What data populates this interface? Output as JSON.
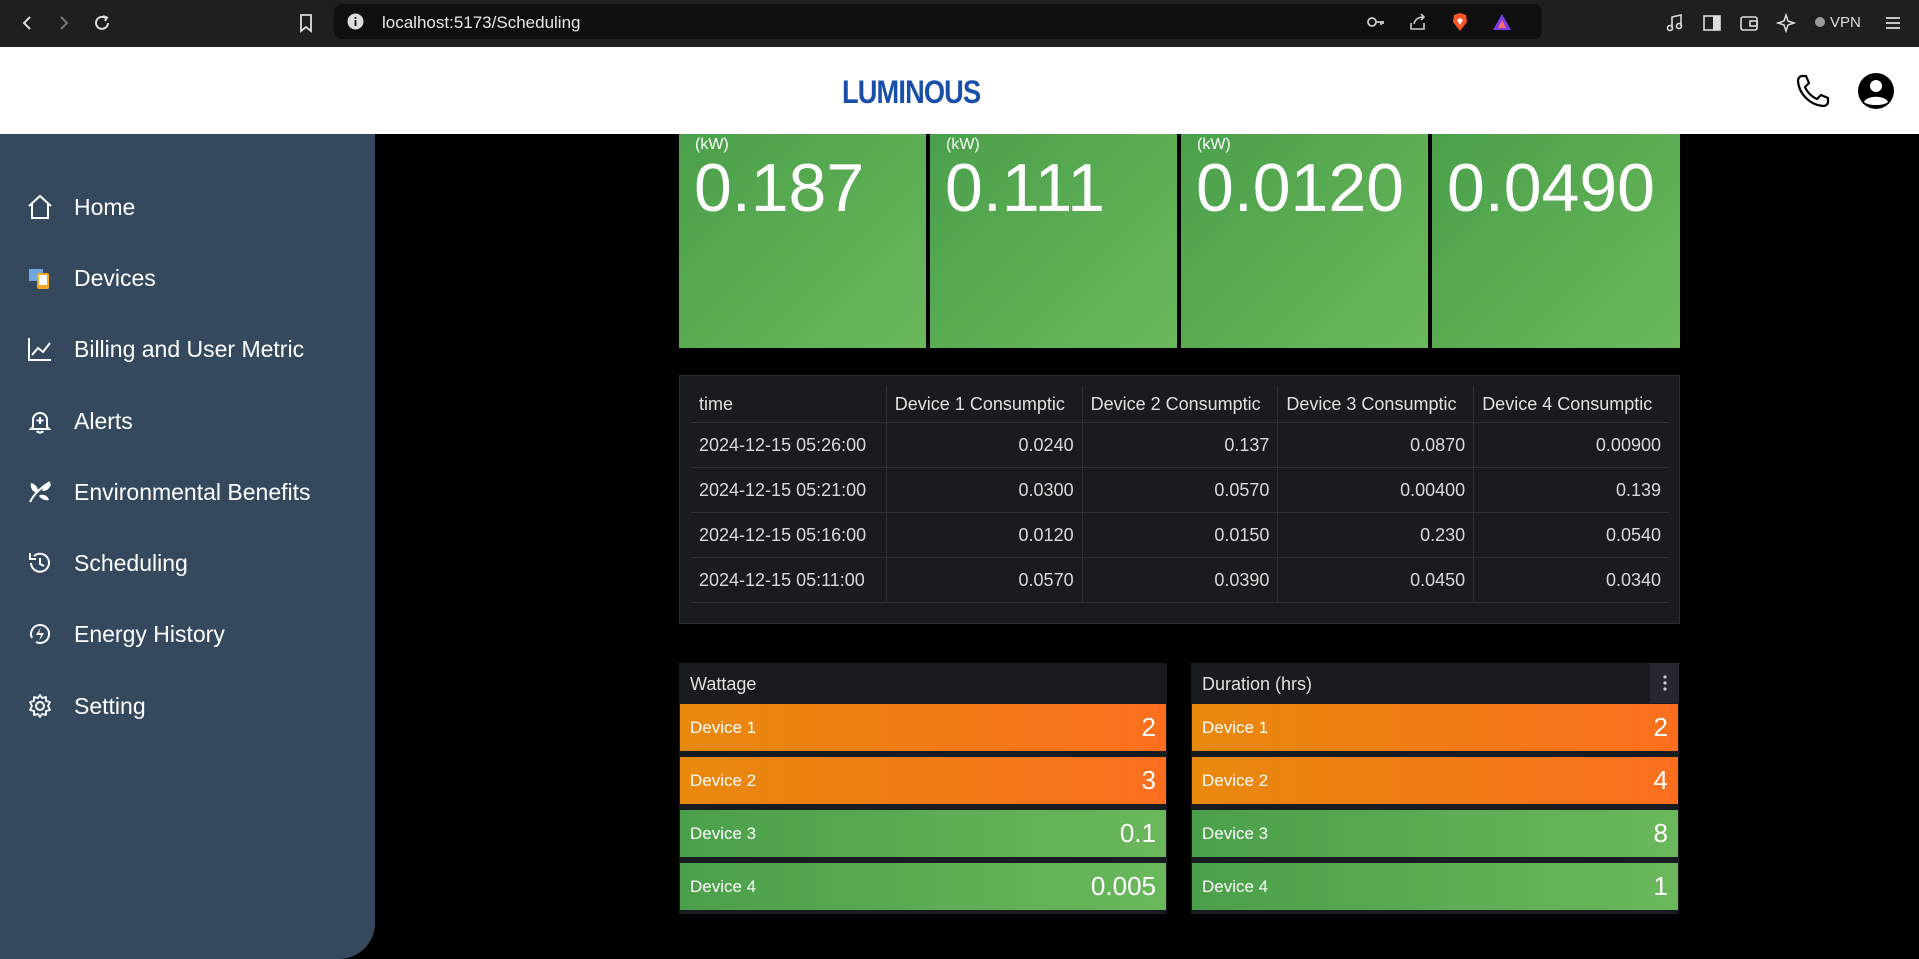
{
  "browser": {
    "url": "localhost:5173/Scheduling",
    "vpn_label": "VPN"
  },
  "header": {
    "logo": "LUMINOUS",
    "icons": [
      "phone-icon",
      "account-icon"
    ]
  },
  "sidebar": {
    "items": [
      {
        "label": "Home",
        "icon": "home-icon"
      },
      {
        "label": "Devices",
        "icon": "devices-icon"
      },
      {
        "label": "Billing and User Metric",
        "icon": "chart-line-icon"
      },
      {
        "label": "Alerts",
        "icon": "bell-icon"
      },
      {
        "label": "Environmental Benefits",
        "icon": "leaf-icon"
      },
      {
        "label": "Scheduling",
        "icon": "history-icon"
      },
      {
        "label": "Energy History",
        "icon": "energy-icon"
      },
      {
        "label": "Setting",
        "icon": "gear-icon"
      }
    ]
  },
  "stats": [
    {
      "unit": "(kW)",
      "value": "0.187"
    },
    {
      "unit": "(kW)",
      "value": "0.111"
    },
    {
      "unit": "(kW)",
      "value": "0.0120"
    },
    {
      "unit": "",
      "value": "0.0490"
    }
  ],
  "table": {
    "columns": [
      "time",
      "Device 1 Consumptic",
      "Device 2 Consumptic",
      "Device 3 Consumptic",
      "Device 4 Consumptic"
    ],
    "rows": [
      [
        "2024-12-15 05:26:00",
        "0.0240",
        "0.137",
        "0.0870",
        "0.00900"
      ],
      [
        "2024-12-15 05:21:00",
        "0.0300",
        "0.0570",
        "0.00400",
        "0.139"
      ],
      [
        "2024-12-15 05:16:00",
        "0.0120",
        "0.0150",
        "0.230",
        "0.0540"
      ],
      [
        "2024-12-15 05:11:00",
        "0.0570",
        "0.0390",
        "0.0450",
        "0.0340"
      ]
    ]
  },
  "wattage": {
    "title": "Wattage",
    "bars": [
      {
        "label": "Device 1",
        "value": "2",
        "color": "#f27b16"
      },
      {
        "label": "Device 2",
        "value": "3",
        "color": "#f27b16"
      },
      {
        "label": "Device 3",
        "value": "0.1",
        "color": "#5aab51"
      },
      {
        "label": "Device 4",
        "value": "0.005",
        "color": "#5aab51"
      }
    ]
  },
  "duration": {
    "title": "Duration (hrs)",
    "bars": [
      {
        "label": "Device 1",
        "value": "2",
        "color": "#f27b16"
      },
      {
        "label": "Device 2",
        "value": "4",
        "color": "#f27b16"
      },
      {
        "label": "Device 3",
        "value": "8",
        "color": "#5aab51"
      },
      {
        "label": "Device 4",
        "value": "1",
        "color": "#5aab51"
      }
    ]
  }
}
